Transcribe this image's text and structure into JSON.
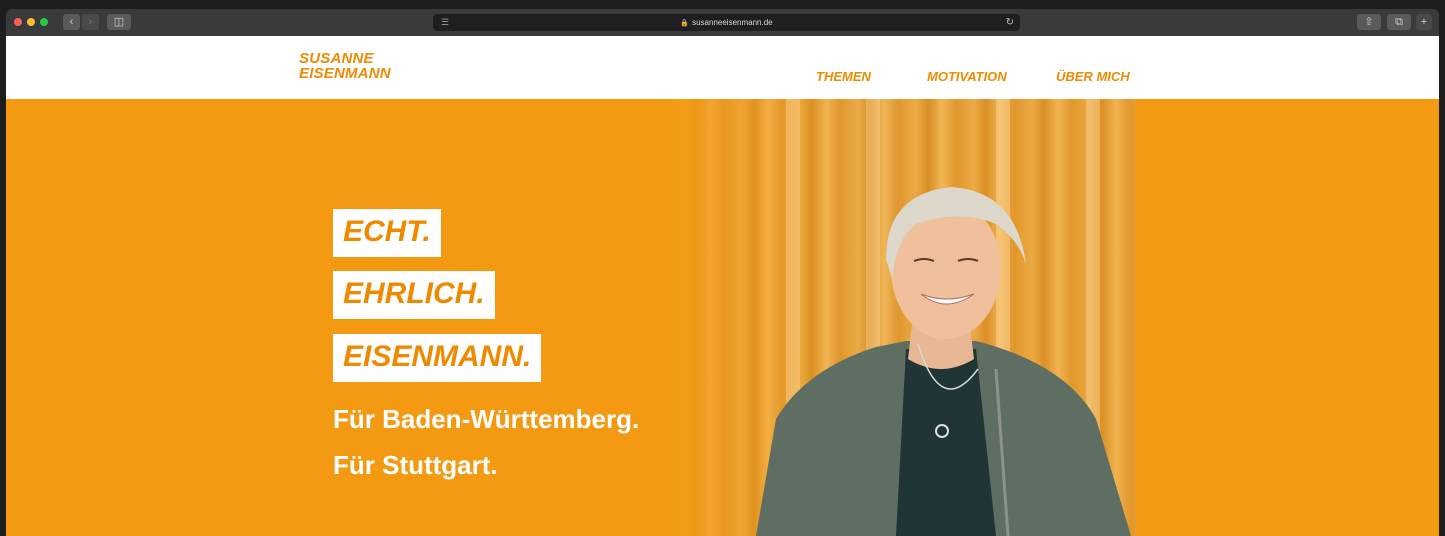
{
  "browser": {
    "url": "susanneeisenmann.de",
    "colors": {
      "close": "#ff5f57",
      "minimize": "#febc2e",
      "zoom": "#28c840"
    }
  },
  "site": {
    "logo_line1": "SUSANNE",
    "logo_line2": "EISENMANN",
    "nav": [
      "THEMEN",
      "MOTIVATION",
      "ÜBER MICH"
    ],
    "accent": "#ef8a00",
    "hero_bg": "#f39a12"
  },
  "hero": {
    "tags": [
      "ECHT.",
      "EHRLICH.",
      "EISENMANN."
    ],
    "lines": [
      "Für Baden-Württemberg.",
      "Für Stuttgart."
    ]
  }
}
